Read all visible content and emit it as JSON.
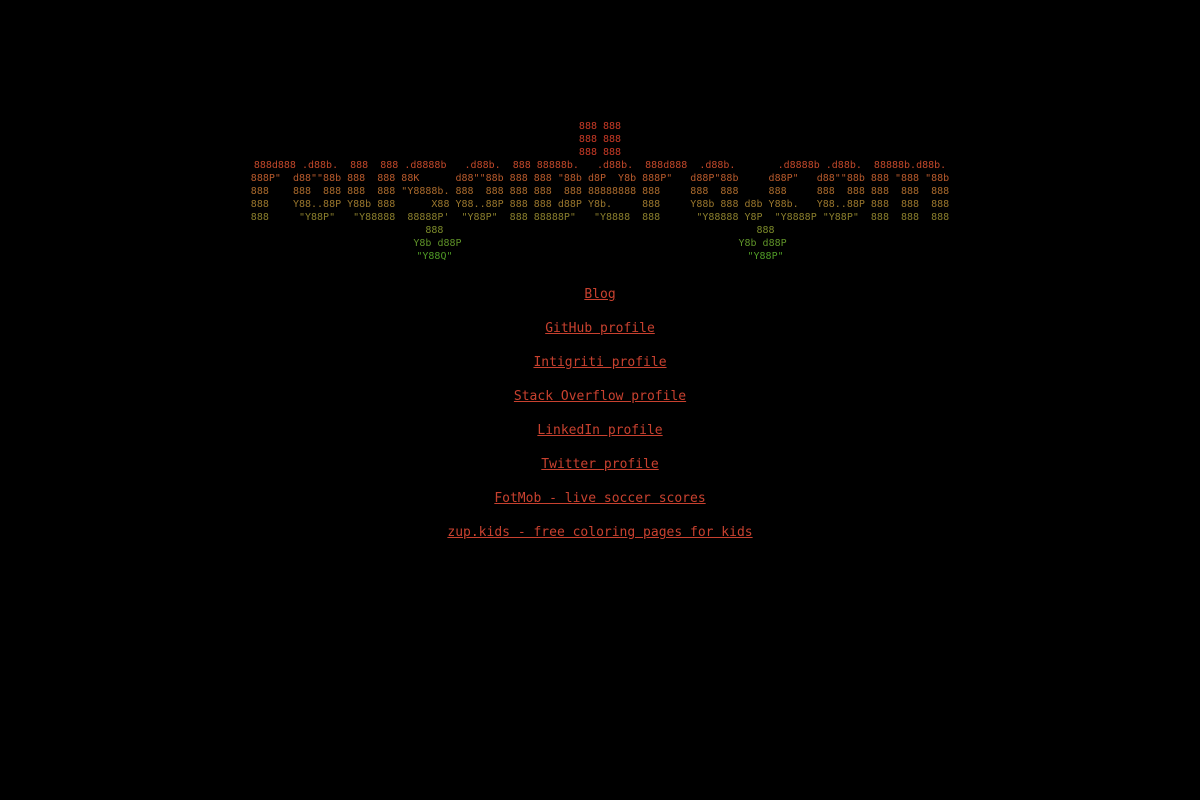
{
  "ascii_art": {
    "lines": [
      {
        "text": "888 888",
        "color": "#c83a26"
      },
      {
        "text": "888 888",
        "color": "#c83a26"
      },
      {
        "text": "888 888",
        "color": "#c83a26"
      },
      {
        "text": "888d888 .d88b.  888  888 .d8888b   .d88b.  888 88888b.   .d88b.  888d888  .d88b.       .d8888b .d88b.  88888b.d88b.",
        "color": "#c2482a"
      },
      {
        "text": "888P\"  d88\"\"88b 888  888 88K      d88\"\"88b 888 888 \"88b d8P  Y8b 888P\"   d88P\"88b     d88P\"   d88\"\"88b 888 \"888 \"88b",
        "color": "#b85a2c"
      },
      {
        "text": "888    888  888 888  888 \"Y8888b. 888  888 888 888  888 88888888 888     888  888     888     888  888 888  888  888",
        "color": "#a96a2c"
      },
      {
        "text": "888    Y88..88P Y88b 888      X88 Y88..88P 888 888 d88P Y8b.     888     Y88b 888 d8b Y88b.   Y88..88P 888  888  888",
        "color": "#99762c"
      },
      {
        "text": "888     \"Y88P\"   \"Y88888  88888P'  \"Y88P\"  888 88888P\"   \"Y8888  888      \"Y88888 Y8P  \"Y8888P \"Y88P\"  888  888  888",
        "color": "#8a7e2c"
      },
      {
        "text": "888                                                    888",
        "color": "#7c8a2a"
      },
      {
        "text": "Y8b d88P                                              Y8b d88P",
        "color": "#5e9228"
      },
      {
        "text": "\"Y88Q\"                                                 \"Y88P\"",
        "color": "#4f9a26"
      }
    ]
  },
  "links": [
    {
      "label": "Blog"
    },
    {
      "label": "GitHub profile"
    },
    {
      "label": "Intigriti profile"
    },
    {
      "label": "Stack Overflow profile"
    },
    {
      "label": "LinkedIn profile"
    },
    {
      "label": "Twitter profile"
    },
    {
      "label": "FotMob - live soccer scores"
    },
    {
      "label": "zup.kids - free coloring pages for kids"
    }
  ],
  "colors": {
    "background": "#000000",
    "link": "#c8412f"
  }
}
